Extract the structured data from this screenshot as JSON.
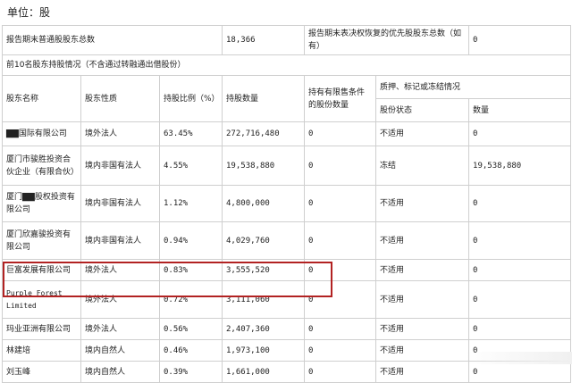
{
  "unit_label": "单位：股",
  "summary": {
    "label1": "报告期末普通股股东总数",
    "value1": "18,366",
    "label2": "报告期末表决权恢复的优先股股东总数（如有）",
    "value2": "0"
  },
  "section_title": "前10名股东持股情况（不含通过转融通出借股份）",
  "headers": {
    "name": "股东名称",
    "nature": "股东性质",
    "ratio": "持股比例（%）",
    "quantity": "持股数量",
    "restricted": "持有有限售条件的股份数量",
    "pledge_group": "质押、标记或冻结情况",
    "pledge_status": "股份状态",
    "pledge_qty": "数量"
  },
  "rows": [
    {
      "name": "▇▇国际有限公司",
      "nature": "境外法人",
      "ratio": "63.45%",
      "quantity": "272,716,480",
      "restricted": "0",
      "status": "不适用",
      "qty": "0"
    },
    {
      "name": "厦门市骏胜投资合伙企业（有限合伙）",
      "nature": "境内非国有法人",
      "ratio": "4.55%",
      "quantity": "19,538,880",
      "restricted": "0",
      "status": "冻结",
      "qty": "19,538,880"
    },
    {
      "name": "厦门▇▇股权投资有限公司",
      "nature": "境内非国有法人",
      "ratio": "1.12%",
      "quantity": "4,800,000",
      "restricted": "0",
      "status": "不适用",
      "qty": "0"
    },
    {
      "name": "厦门欣嘉骏投资有限公司",
      "nature": "境内非国有法人",
      "ratio": "0.94%",
      "quantity": "4,029,760",
      "restricted": "0",
      "status": "不适用",
      "qty": "0"
    },
    {
      "name": "巨富发展有限公司",
      "nature": "境外法人",
      "ratio": "0.83%",
      "quantity": "3,555,520",
      "restricted": "0",
      "status": "不适用",
      "qty": "0"
    },
    {
      "name": "Purple Forest Limited",
      "nature": "境外法人",
      "ratio": "0.72%",
      "quantity": "3,111,060",
      "restricted": "0",
      "status": "不适用",
      "qty": "0"
    },
    {
      "name": "玛业亚洲有限公司",
      "nature": "境外法人",
      "ratio": "0.56%",
      "quantity": "2,407,360",
      "restricted": "0",
      "status": "不适用",
      "qty": "0"
    },
    {
      "name": "林建培",
      "nature": "境内自然人",
      "ratio": "0.46%",
      "quantity": "1,973,100",
      "restricted": "0",
      "status": "不适用",
      "qty": "0"
    },
    {
      "name": "刘玉峰",
      "nature": "境内自然人",
      "ratio": "0.39%",
      "quantity": "1,661,000",
      "restricted": "0",
      "status": "不适用",
      "qty": "0"
    }
  ]
}
